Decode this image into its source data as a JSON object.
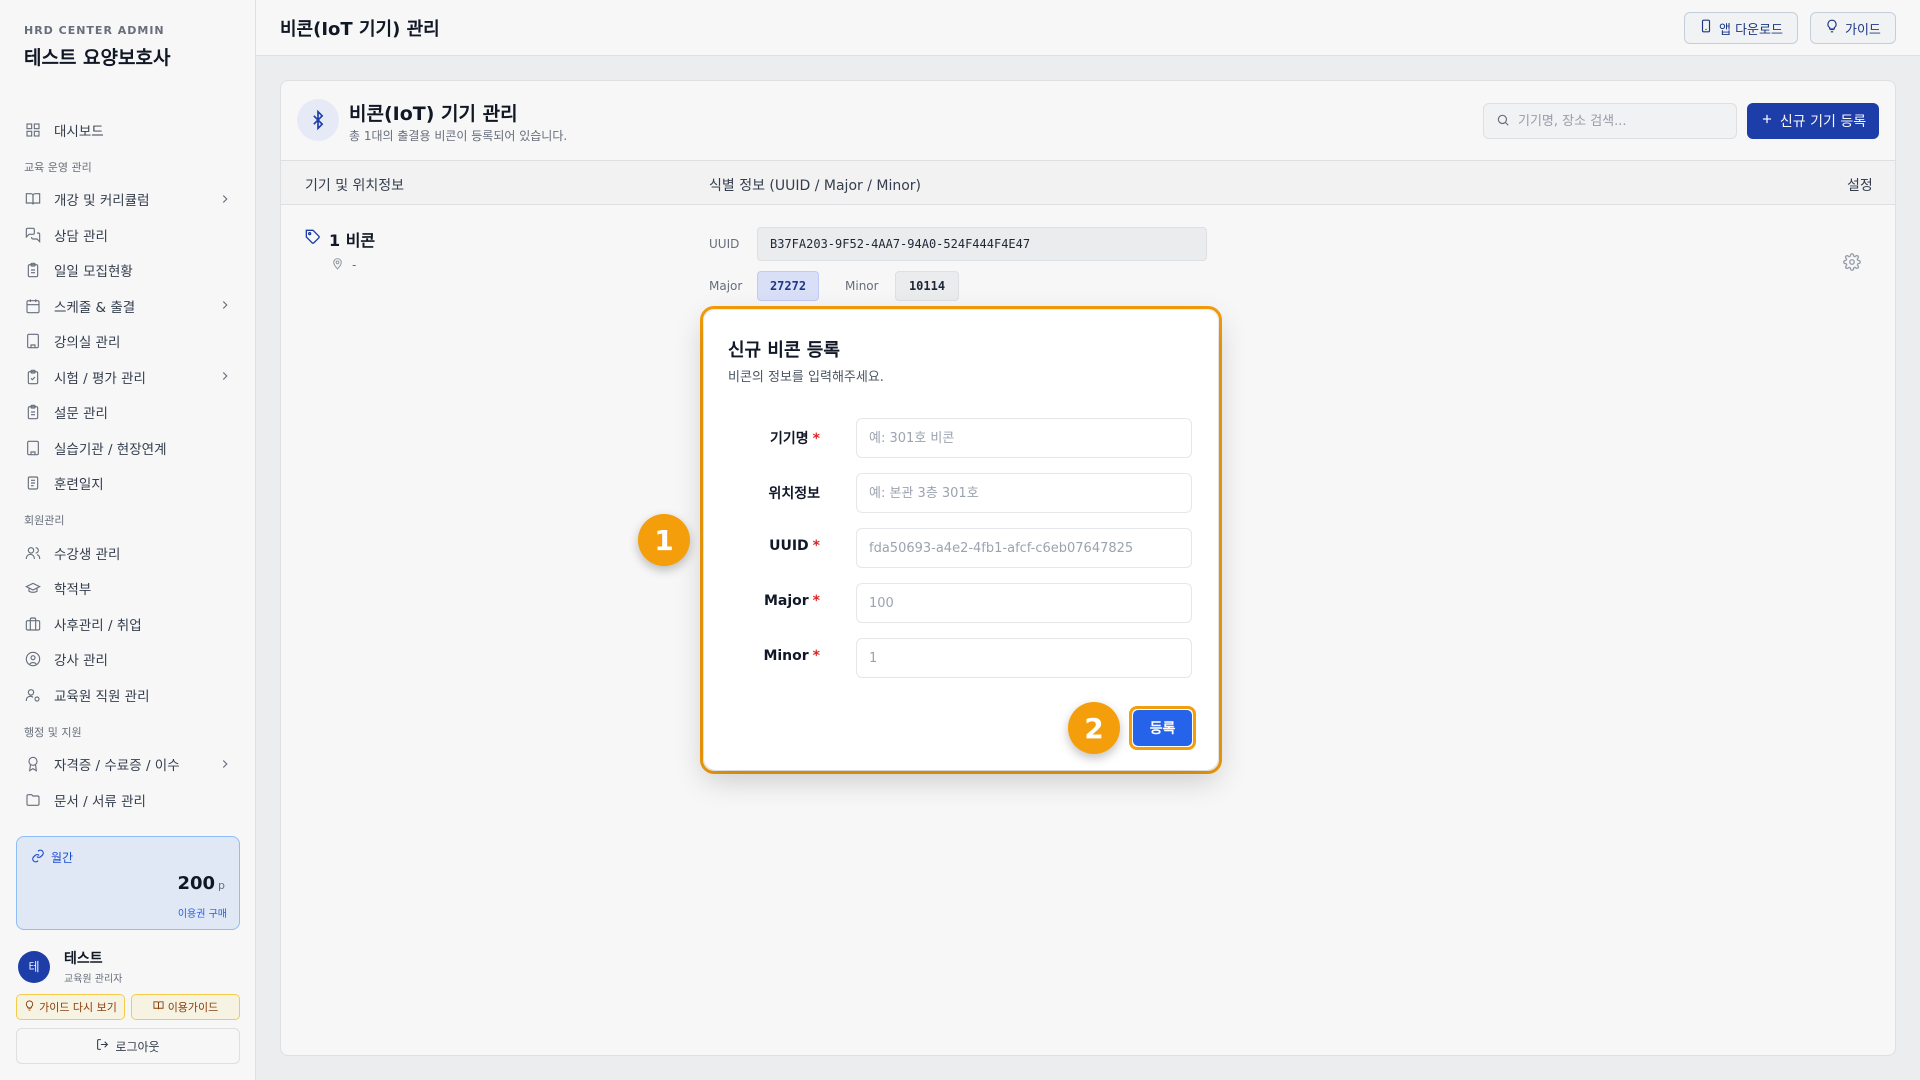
{
  "brand": {
    "sub": "HRD CENTER ADMIN",
    "title": "테스트 요양보호사"
  },
  "sidebar": {
    "items": [
      {
        "type": "item",
        "label": "대시보드",
        "icon": "grid-icon"
      },
      {
        "type": "section",
        "label": "교육 운영 관리"
      },
      {
        "type": "item",
        "label": "개강 및 커리큘럼",
        "icon": "book-icon",
        "chevron": true
      },
      {
        "type": "item",
        "label": "상담 관리",
        "icon": "chat-icon"
      },
      {
        "type": "item",
        "label": "일일 모집현황",
        "icon": "clipboard-icon"
      },
      {
        "type": "item",
        "label": "스케줄 & 출결",
        "icon": "calendar-icon",
        "chevron": true
      },
      {
        "type": "item",
        "label": "강의실 관리",
        "icon": "building-icon"
      },
      {
        "type": "item",
        "label": "시험 / 평가 관리",
        "icon": "clipboard-check-icon",
        "chevron": true
      },
      {
        "type": "item",
        "label": "설문 관리",
        "icon": "clipboard-icon"
      },
      {
        "type": "item",
        "label": "실습기관 / 현장연계",
        "icon": "building-icon"
      },
      {
        "type": "item",
        "label": "훈련일지",
        "icon": "notebook-icon"
      },
      {
        "type": "section",
        "label": "회원관리"
      },
      {
        "type": "item",
        "label": "수강생 관리",
        "icon": "users-icon"
      },
      {
        "type": "item",
        "label": "학적부",
        "icon": "graduation-icon"
      },
      {
        "type": "item",
        "label": "사후관리 / 취업",
        "icon": "briefcase-icon"
      },
      {
        "type": "item",
        "label": "강사 관리",
        "icon": "user-circle-icon"
      },
      {
        "type": "item",
        "label": "교육원 직원 관리",
        "icon": "user-cog-icon"
      },
      {
        "type": "section",
        "label": "행정 및 지원"
      },
      {
        "type": "item",
        "label": "자격증 / 수료증 / 이수",
        "icon": "award-icon",
        "chevron": true
      },
      {
        "type": "item",
        "label": "문서 / 서류 관리",
        "icon": "folder-icon"
      }
    ],
    "credit": {
      "label": "월간",
      "value": "200",
      "unit": "p",
      "buy": "이용권 구매"
    },
    "user": {
      "initial": "테",
      "name": "테스트",
      "role": "교육원 관리자"
    },
    "guide_again": "가이드 다시 보기",
    "usage_guide": "이용가이드",
    "logout": "로그아웃"
  },
  "header": {
    "title": "비콘(IoT 기기) 관리",
    "app_download": "앱 다운로드",
    "guide": "가이드"
  },
  "card": {
    "title": "비콘(IoT) 기기 관리",
    "subtitle": "총 1대의 출결용 비콘이 등록되어 있습니다.",
    "search_placeholder": "기기명, 장소 검색...",
    "register_button": "신규 기기 등록",
    "columns": [
      "기기 및 위치정보",
      "식별 정보 (UUID / Major / Minor)",
      "설정"
    ],
    "row": {
      "name": "1 비콘",
      "location": "-",
      "uuid_label": "UUID",
      "uuid": "B37FA203-9F52-4AA7-94A0-524F444F4E47",
      "major_label": "Major",
      "major": "27272",
      "minor_label": "Minor",
      "minor": "10114"
    }
  },
  "modal": {
    "title": "신규 비콘 등록",
    "subtitle": "비콘의 정보를 입력해주세요.",
    "fields": [
      {
        "label": "기기명",
        "required": true,
        "placeholder": "예: 301호 비콘"
      },
      {
        "label": "위치정보",
        "required": false,
        "placeholder": "예: 본관 3층 301호"
      },
      {
        "label": "UUID",
        "required": true,
        "placeholder": "fda50693-a4e2-4fb1-afcf-c6eb07647825"
      },
      {
        "label": "Major",
        "required": true,
        "placeholder": "100"
      },
      {
        "label": "Minor",
        "required": true,
        "placeholder": "1"
      }
    ],
    "required_mark": "*",
    "submit": "등록"
  },
  "badges": [
    "1",
    "2"
  ],
  "colors": {
    "accent": "#1e40af",
    "highlight": "#f59e0b",
    "submit": "#2563eb"
  }
}
